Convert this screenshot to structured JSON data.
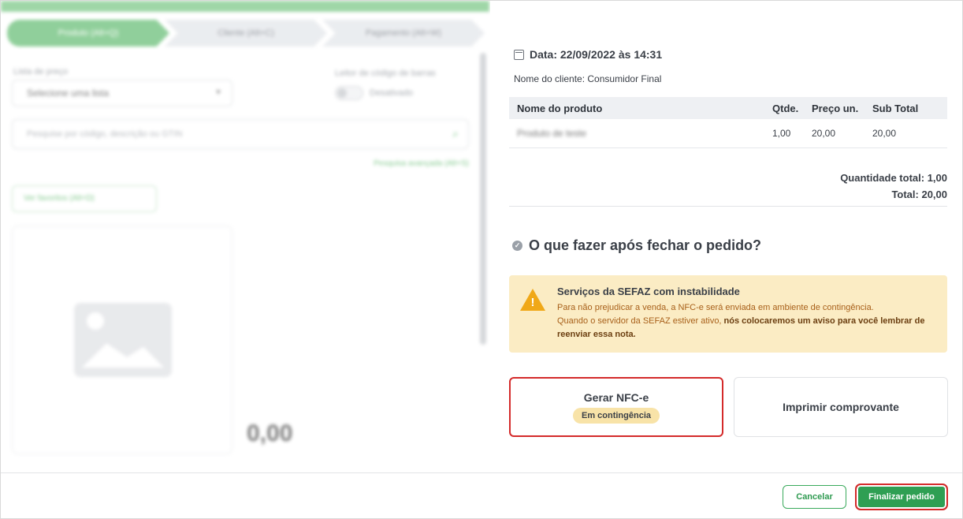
{
  "background": {
    "steps": [
      "Produto (Alt+Q)",
      "Cliente (Alt+C)",
      "Pagamento (Alt+W)"
    ],
    "price_list_label": "Lista de preço",
    "price_list_value": "Selecione uma lista",
    "barcode_label": "Leitor de código de barras",
    "barcode_state": "Desativado",
    "search_placeholder": "Pesquise por código, descrição ou GTIN",
    "advanced_search": "Pesquisa avançada (Alt+S)",
    "favorites": "Ver favoritos (Alt+D)",
    "price": "0,00"
  },
  "modal": {
    "date_label": "Data: 22/09/2022 às 14:31",
    "client_label": "Nome do cliente: Consumidor Final",
    "table": {
      "headers": [
        "Nome do produto",
        "Qtde.",
        "Preço un.",
        "Sub Total"
      ],
      "rows": [
        {
          "name": "Produto de teste",
          "qty": "1,00",
          "unit_price": "20,00",
          "subtotal": "20,00"
        }
      ]
    },
    "total_quantity": "Quantidade total: 1,00",
    "total": "Total: 20,00",
    "question": "O que fazer após fechar o pedido?",
    "warning": {
      "title": "Serviços da SEFAZ com instabilidade",
      "line1": "Para não prejudicar a venda, a NFC-e será enviada em ambiente de contingência.",
      "line2_prefix": "Quando o servidor da SEFAZ estiver ativo, ",
      "line2_bold": "nós colocaremos um aviso para você lembrar de reenviar essa nota."
    },
    "options": {
      "nfce_title": "Gerar NFC-e",
      "nfce_badge": "Em contingência",
      "print_title": "Imprimir comprovante"
    }
  },
  "footer": {
    "cancel_label": "Cancelar",
    "finalize_label": "Finalizar pedido"
  },
  "colors": {
    "accent": "#2f9f53",
    "highlight": "#d42a2a",
    "warning_bg": "#fbecc4",
    "warning_icon": "#f0a818"
  }
}
